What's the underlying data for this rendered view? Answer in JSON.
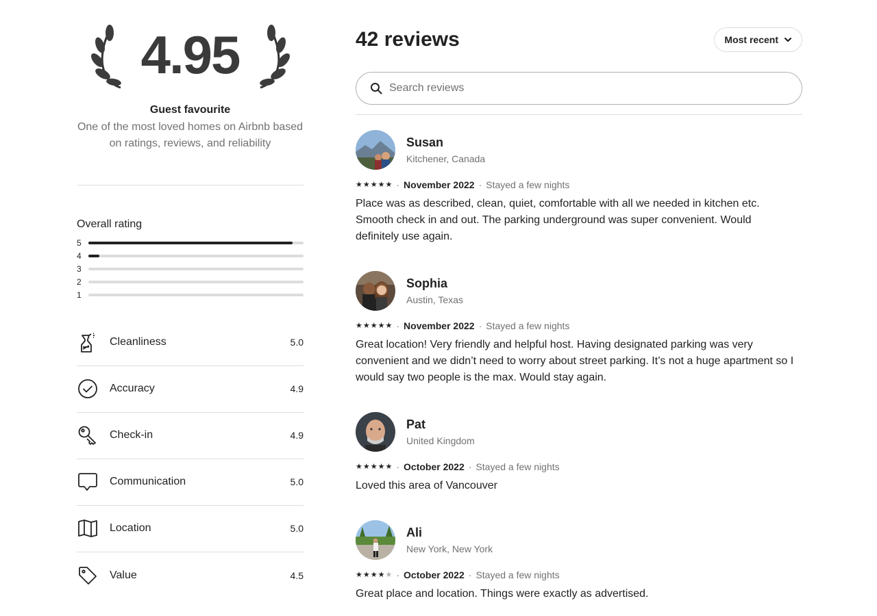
{
  "summary": {
    "score": "4.95",
    "badge_title": "Guest favourite",
    "badge_desc": "One of the most loved homes on Airbnb based on ratings, reviews, and reliability"
  },
  "overall": {
    "title": "Overall rating",
    "distribution": [
      {
        "label": "5",
        "fraction": 0.95
      },
      {
        "label": "4",
        "fraction": 0.05
      },
      {
        "label": "3",
        "fraction": 0.0
      },
      {
        "label": "2",
        "fraction": 0.0
      },
      {
        "label": "1",
        "fraction": 0.0
      }
    ]
  },
  "categories": [
    {
      "label": "Cleanliness",
      "value": "5.0",
      "icon": "spray-bottle-icon"
    },
    {
      "label": "Accuracy",
      "value": "4.9",
      "icon": "check-circle-icon"
    },
    {
      "label": "Check-in",
      "value": "4.9",
      "icon": "key-icon"
    },
    {
      "label": "Communication",
      "value": "5.0",
      "icon": "speech-bubble-icon"
    },
    {
      "label": "Location",
      "value": "5.0",
      "icon": "map-icon"
    },
    {
      "label": "Value",
      "value": "4.5",
      "icon": "price-tag-icon"
    }
  ],
  "reviews_header": {
    "count_label": "42 reviews",
    "sort_label": "Most recent"
  },
  "search": {
    "placeholder": "Search reviews"
  },
  "reviews": [
    {
      "name": "Susan",
      "location": "Kitchener, Canada",
      "stars": 5,
      "date": "November 2022",
      "stay": "Stayed a few nights",
      "text": "Place was as described, clean, quiet, comfortable with all we needed in kitchen etc. Smooth check in and out. The parking underground was super convenient. Would definitely use again."
    },
    {
      "name": "Sophia",
      "location": "Austin, Texas",
      "stars": 5,
      "date": "November 2022",
      "stay": "Stayed a few nights",
      "text": "Great location! Very friendly and helpful host. Having designated parking was very convenient and we didn’t need to worry about street parking. It’s not a huge apartment so I would say two people is the max. Would stay again."
    },
    {
      "name": "Pat",
      "location": "United Kingdom",
      "stars": 5,
      "date": "October 2022",
      "stay": "Stayed a few nights",
      "text": "Loved this area of Vancouver"
    },
    {
      "name": "Ali",
      "location": "New York, New York",
      "stars": 4,
      "date": "October 2022",
      "stay": "Stayed a few nights",
      "text": "Great place and location. Things were exactly as advertised."
    }
  ],
  "colors": {
    "text": "#222222",
    "muted": "#717171",
    "divider": "#dddddd",
    "bar_fill": "#222222"
  }
}
